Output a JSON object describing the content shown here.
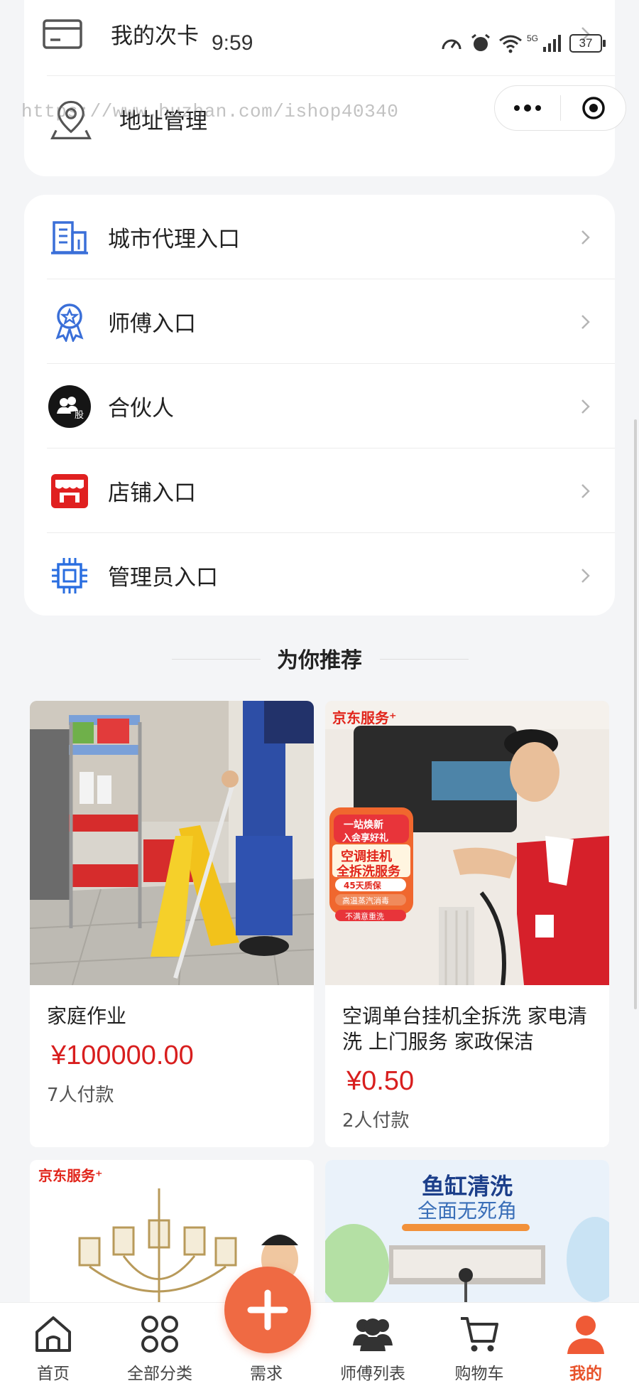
{
  "status_bar": {
    "time": "9:59",
    "network": "5G",
    "battery": "37"
  },
  "watermark": "https://www.huzhan.com/ishop40340",
  "top_card": {
    "items": [
      {
        "label": "我的次卡",
        "icon": "card-icon"
      },
      {
        "label": "地址管理",
        "icon": "location-pin-icon"
      }
    ]
  },
  "menu": {
    "items": [
      {
        "label": "城市代理入口",
        "icon": "building-icon",
        "color": "#3a6fd8"
      },
      {
        "label": "师傅入口",
        "icon": "badge-star-icon",
        "color": "#3a6fd8"
      },
      {
        "label": "合伙人",
        "icon": "partner-icon",
        "color": "#111111"
      },
      {
        "label": "店铺入口",
        "icon": "shop-icon",
        "color": "#e02020"
      },
      {
        "label": "管理员入口",
        "icon": "chip-icon",
        "color": "#2a6ee0"
      }
    ]
  },
  "recommend": {
    "title": "为你推荐",
    "products": [
      {
        "name": "家庭作业",
        "price": "¥100000.00",
        "sold": "7人付款"
      },
      {
        "name": "空调单台挂机全拆洗 家电清洗 上门服务 家政保洁",
        "price": "¥0.50",
        "sold": "2人付款",
        "banner": {
          "brand": "京东服务⁺",
          "promo1": "一站焕新",
          "promo2": "入会享好礼",
          "headline1": "空调挂机",
          "headline2": "全拆洗服务",
          "tag1": "45天质保",
          "tag2": "高温蒸汽消毒",
          "tag3": "不满意重洗"
        }
      },
      {
        "name": "",
        "banner": {
          "brand": "京东服务⁺"
        }
      },
      {
        "name": "",
        "banner": {
          "headline1": "鱼缸清洗",
          "headline2": "全面无死角"
        }
      }
    ]
  },
  "tabbar": {
    "tabs": [
      {
        "label": "首页",
        "icon": "home-icon"
      },
      {
        "label": "全部分类",
        "icon": "grid-icon"
      },
      {
        "label": "需求",
        "icon": "plus-icon"
      },
      {
        "label": "师傅列表",
        "icon": "users-icon"
      },
      {
        "label": "购物车",
        "icon": "cart-icon"
      },
      {
        "label": "我的",
        "icon": "user-icon",
        "active": true
      }
    ],
    "accent": "#e8532b"
  }
}
